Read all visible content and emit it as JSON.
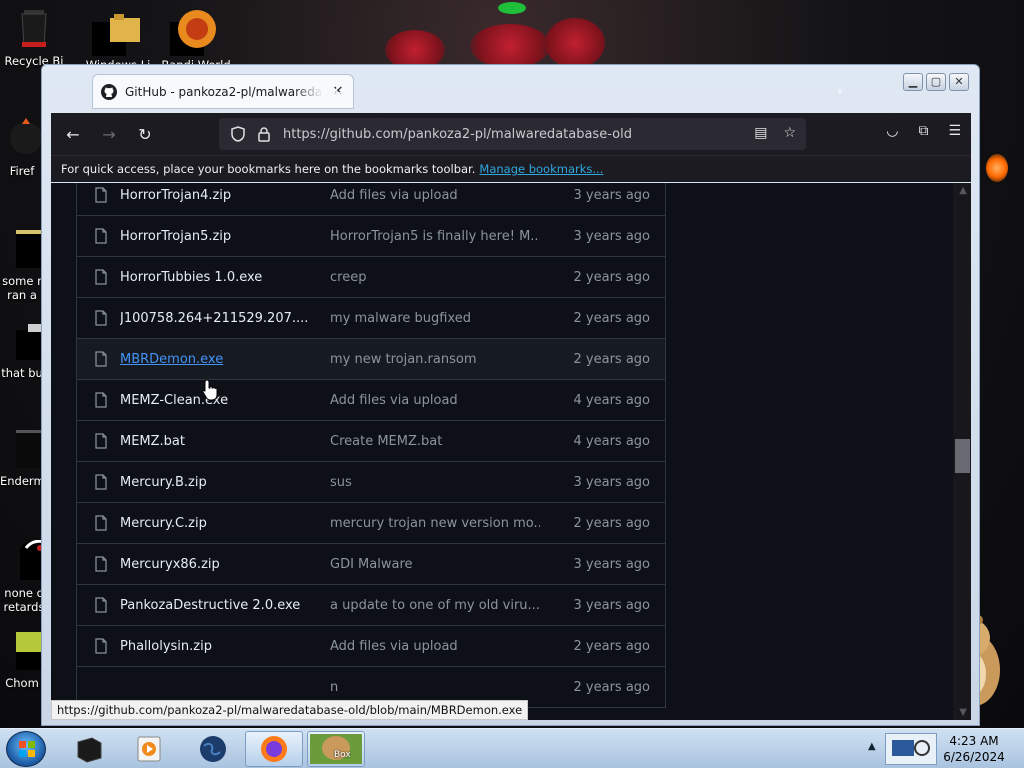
{
  "desktop": {
    "icons": [
      {
        "label": "Recycle Bi",
        "id": "recycle"
      },
      {
        "label": "Firef",
        "id": "firefox"
      },
      {
        "label": "some r\nran a",
        "id": "some"
      },
      {
        "label": "that bu",
        "id": "thatbu"
      },
      {
        "label": "Enderm",
        "id": "enderm"
      },
      {
        "label": "none o\nretards",
        "id": "none"
      },
      {
        "label": "Chom",
        "id": "chom"
      }
    ],
    "top_labels": [
      "Windows Li",
      "Bandi World"
    ]
  },
  "browser": {
    "tab_title": "GitHub - pankoza2-pl/malwaredatabase-old",
    "tab_close": "✕",
    "new_tab": "+",
    "url": "https://github.com/pankoza2-pl/malwaredatabase-old",
    "bookmarks_text": "For quick access, place your bookmarks here on the bookmarks toolbar.",
    "bookmarks_link": "Manage bookmarks...",
    "status_url": "https://github.com/pankoza2-pl/malwaredatabase-old/blob/main/MBRDemon.exe"
  },
  "files": [
    {
      "name": "HorrorTrojan4.zip",
      "message": "Add files via upload",
      "age": "3 years ago"
    },
    {
      "name": "HorrorTrojan5.zip",
      "message": "HorrorTrojan5 is finally here! M...",
      "age": "3 years ago"
    },
    {
      "name": "HorrorTubbies 1.0.exe",
      "message": "creep",
      "age": "2 years ago"
    },
    {
      "name": "J100758.264+211529.207....",
      "message": "my malware bugfixed",
      "age": "2 years ago"
    },
    {
      "name": "MBRDemon.exe",
      "message": "my new trojan.ransom",
      "age": "2 years ago"
    },
    {
      "name": "MEMZ-Clean.exe",
      "message": "Add files via upload",
      "age": "4 years ago"
    },
    {
      "name": "MEMZ.bat",
      "message": "Create MEMZ.bat",
      "age": "4 years ago"
    },
    {
      "name": "Mercury.B.zip",
      "message": "sus",
      "age": "3 years ago"
    },
    {
      "name": "Mercury.C.zip",
      "message": "mercury trojan new version mo...",
      "age": "2 years ago"
    },
    {
      "name": "Mercuryx86.zip",
      "message": "GDI Malware",
      "age": "3 years ago"
    },
    {
      "name": "PankozaDestructive 2.0.exe",
      "message": "a update to one of my old viru...",
      "age": "3 years ago"
    },
    {
      "name": "Phallolysin.zip",
      "message": "Add files via upload",
      "age": "2 years ago"
    },
    {
      "name": "",
      "message": "n",
      "age": "2 years ago"
    }
  ],
  "taskbar": {
    "time": "4:23 AM",
    "date": "6/26/2024",
    "box_label": "Box"
  }
}
